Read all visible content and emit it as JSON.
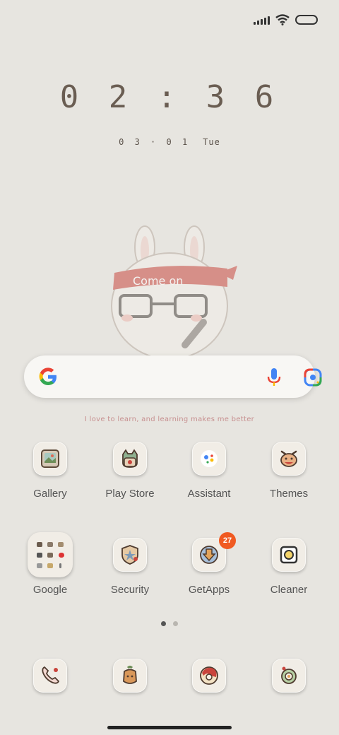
{
  "clock": {
    "time": "0 2 : 3 6",
    "day": "0 3 · 0 1",
    "weekday": "Tue"
  },
  "motto": "I love to learn, and learning makes me better",
  "search": {
    "icon": "google-g-icon"
  },
  "art_text": "Come on",
  "apps": [
    {
      "label": "Gallery",
      "icon": "gallery-icon"
    },
    {
      "label": "Play Store",
      "icon": "play-store-icon"
    },
    {
      "label": "Assistant",
      "icon": "assistant-icon"
    },
    {
      "label": "Themes",
      "icon": "themes-icon"
    },
    {
      "label": "Google",
      "icon": "folder-icon"
    },
    {
      "label": "Security",
      "icon": "security-icon"
    },
    {
      "label": "GetApps",
      "icon": "getapps-icon",
      "badge": "27"
    },
    {
      "label": "Cleaner",
      "icon": "cleaner-icon"
    }
  ],
  "dock": [
    {
      "icon": "phone-icon"
    },
    {
      "icon": "messages-icon"
    },
    {
      "icon": "browser-icon"
    },
    {
      "icon": "camera-icon"
    }
  ],
  "colors": {
    "wallpaper": "#e7e5e0",
    "badge": "#f05a22",
    "clock": "#6a5d52"
  }
}
